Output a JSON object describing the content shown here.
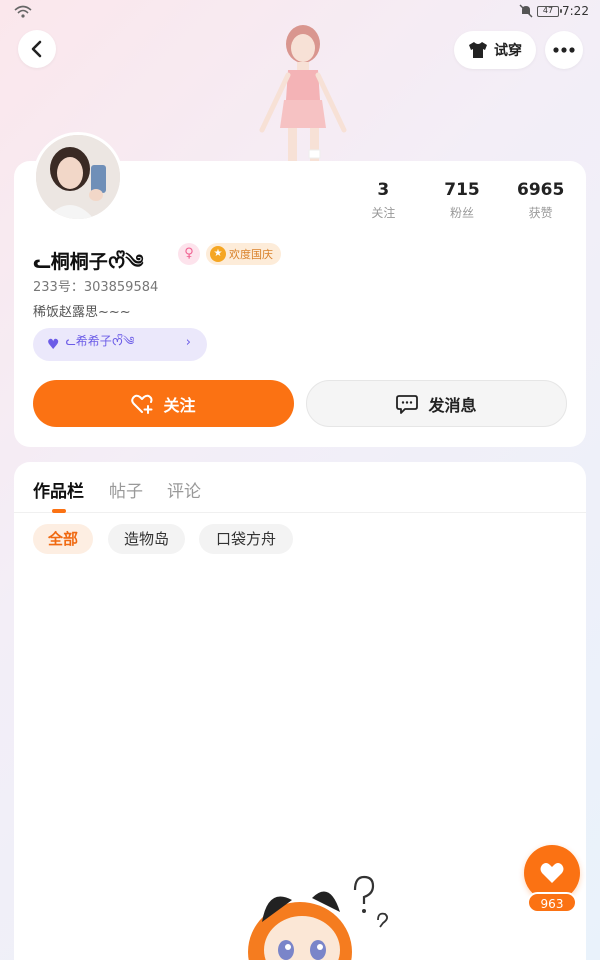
{
  "status_bar": {
    "time": "7:22",
    "battery": "47"
  },
  "header": {
    "tryon_label": "试穿"
  },
  "profile": {
    "username": "ᓚ桐桐子ᰔᩚ༄",
    "uid": "233号：303859584",
    "bio": "稀饭赵露思~~~",
    "gender_icon": "female-icon",
    "festival_badge": "欢度国庆",
    "partner_name": "ᓚ希希子ᰔᩚ༄"
  },
  "stats": [
    {
      "value": "3",
      "label": "关注"
    },
    {
      "value": "715",
      "label": "粉丝"
    },
    {
      "value": "6965",
      "label": "获赞"
    }
  ],
  "actions": {
    "follow_label": "关注",
    "message_label": "发消息"
  },
  "tabs": [
    {
      "label": "作品栏",
      "active": true
    },
    {
      "label": "帖子",
      "active": false
    },
    {
      "label": "评论",
      "active": false
    }
  ],
  "filters": [
    {
      "label": "全部",
      "active": true
    },
    {
      "label": "造物岛",
      "active": false
    },
    {
      "label": "口袋方舟",
      "active": false
    }
  ],
  "like": {
    "count": "963"
  },
  "colors": {
    "accent": "#fb7213",
    "partner": "#6c5ce7",
    "badge": "#f5a623"
  }
}
